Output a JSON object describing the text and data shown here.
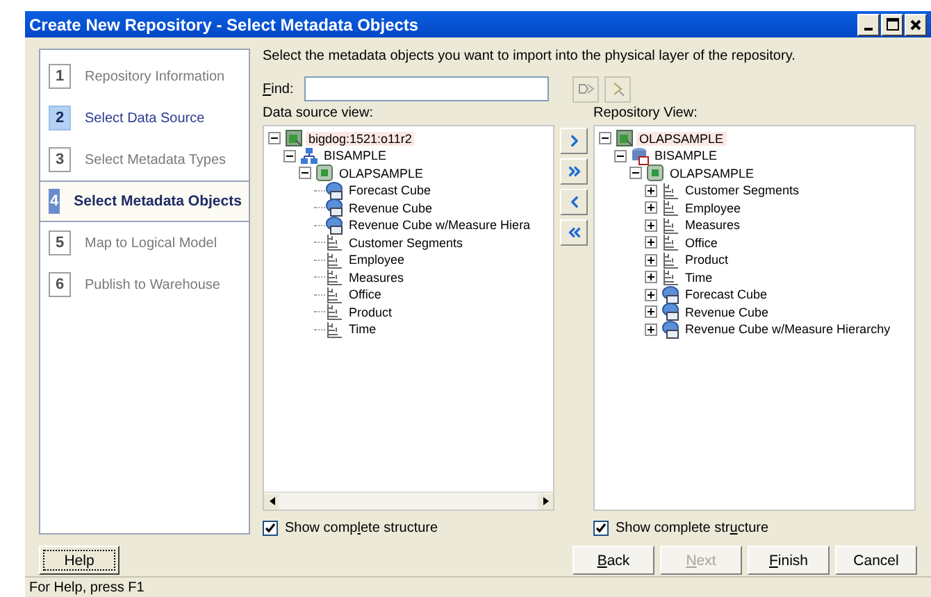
{
  "window": {
    "title": "Create New Repository - Select Metadata Objects"
  },
  "steps": [
    {
      "number": "1",
      "label": "Repository Information",
      "selected": false,
      "highlighted": false
    },
    {
      "number": "2",
      "label": "Select Data Source",
      "selected": false,
      "highlighted": true
    },
    {
      "number": "3",
      "label": "Select Metadata Types",
      "selected": false,
      "highlighted": false
    },
    {
      "number": "4",
      "label": "Select Metadata Objects",
      "selected": true,
      "highlighted": false
    },
    {
      "number": "5",
      "label": "Map to Logical Model",
      "selected": false,
      "highlighted": false
    },
    {
      "number": "6",
      "label": "Publish to Warehouse",
      "selected": false,
      "highlighted": false
    }
  ],
  "instruction": "Select the metadata objects you want to import into the physical layer of the repository.",
  "find": {
    "key": "F",
    "after": "ind:"
  },
  "source_view": {
    "label": "Data source view:",
    "checkbox": {
      "before": "Show comp",
      "key": "l",
      "after": "ete structure",
      "checked": true
    },
    "tree": [
      {
        "kind": "server",
        "label": "bigdog:1521:o11r2",
        "expandable": true,
        "expanded": true,
        "selected": true,
        "children": [
          {
            "kind": "schema",
            "label": "BISAMPLE",
            "expandable": true,
            "expanded": true,
            "selected": false,
            "children": [
              {
                "kind": "catalog",
                "label": "OLAPSAMPLE",
                "expandable": true,
                "expanded": true,
                "selected": false,
                "children": [
                  {
                    "kind": "cube",
                    "label": "Forecast Cube",
                    "expandable": false,
                    "selected": false
                  },
                  {
                    "kind": "cube",
                    "label": "Revenue Cube",
                    "expandable": false,
                    "selected": false
                  },
                  {
                    "kind": "cube",
                    "label": "Revenue Cube w/Measure Hiera",
                    "expandable": false,
                    "selected": false
                  },
                  {
                    "kind": "dimension",
                    "label": "Customer Segments",
                    "expandable": false,
                    "selected": false
                  },
                  {
                    "kind": "dimension",
                    "label": "Employee",
                    "expandable": false,
                    "selected": false
                  },
                  {
                    "kind": "dimension",
                    "label": "Measures",
                    "expandable": false,
                    "selected": false
                  },
                  {
                    "kind": "dimension",
                    "label": "Office",
                    "expandable": false,
                    "selected": false
                  },
                  {
                    "kind": "dimension",
                    "label": "Product",
                    "expandable": false,
                    "selected": false
                  },
                  {
                    "kind": "dimension",
                    "label": "Time",
                    "expandable": false,
                    "selected": false
                  }
                ]
              }
            ]
          }
        ]
      }
    ]
  },
  "repository_view": {
    "label": "Repository View:",
    "checkbox": {
      "before": "Show complete str",
      "key": "u",
      "after": "cture",
      "checked": true
    },
    "tree": [
      {
        "kind": "server",
        "label": "OLAPSAMPLE",
        "expandable": true,
        "expanded": true,
        "selected": true,
        "children": [
          {
            "kind": "database",
            "label": "BISAMPLE",
            "expandable": true,
            "expanded": true,
            "selected": false,
            "children": [
              {
                "kind": "catalog",
                "label": "OLAPSAMPLE",
                "expandable": true,
                "expanded": true,
                "selected": false,
                "children": [
                  {
                    "kind": "dimension",
                    "label": "Customer Segments",
                    "expandable": true,
                    "expanded": false,
                    "selected": false
                  },
                  {
                    "kind": "dimension",
                    "label": "Employee",
                    "expandable": true,
                    "expanded": false,
                    "selected": false
                  },
                  {
                    "kind": "dimension",
                    "label": "Measures",
                    "expandable": true,
                    "expanded": false,
                    "selected": false
                  },
                  {
                    "kind": "dimension",
                    "label": "Office",
                    "expandable": true,
                    "expanded": false,
                    "selected": false
                  },
                  {
                    "kind": "dimension",
                    "label": "Product",
                    "expandable": true,
                    "expanded": false,
                    "selected": false
                  },
                  {
                    "kind": "dimension",
                    "label": "Time",
                    "expandable": true,
                    "expanded": false,
                    "selected": false
                  },
                  {
                    "kind": "cube",
                    "label": "Forecast Cube",
                    "expandable": true,
                    "expanded": false,
                    "selected": false
                  },
                  {
                    "kind": "cube",
                    "label": "Revenue Cube",
                    "expandable": true,
                    "expanded": false,
                    "selected": false
                  },
                  {
                    "kind": "cube",
                    "label": "Revenue Cube w/Measure Hierarchy",
                    "expandable": true,
                    "expanded": false,
                    "selected": false
                  }
                ]
              }
            ]
          }
        ]
      }
    ]
  },
  "help_button": {
    "label": "Help"
  },
  "buttons": [
    {
      "key": "B",
      "after": "ack",
      "disabled": false
    },
    {
      "key": "N",
      "after": "ext",
      "disabled": true
    },
    {
      "key": "F",
      "after": "inish",
      "disabled": false
    },
    {
      "after": "Cancel",
      "disabled": false
    }
  ],
  "status_bar": "For Help, press F1"
}
